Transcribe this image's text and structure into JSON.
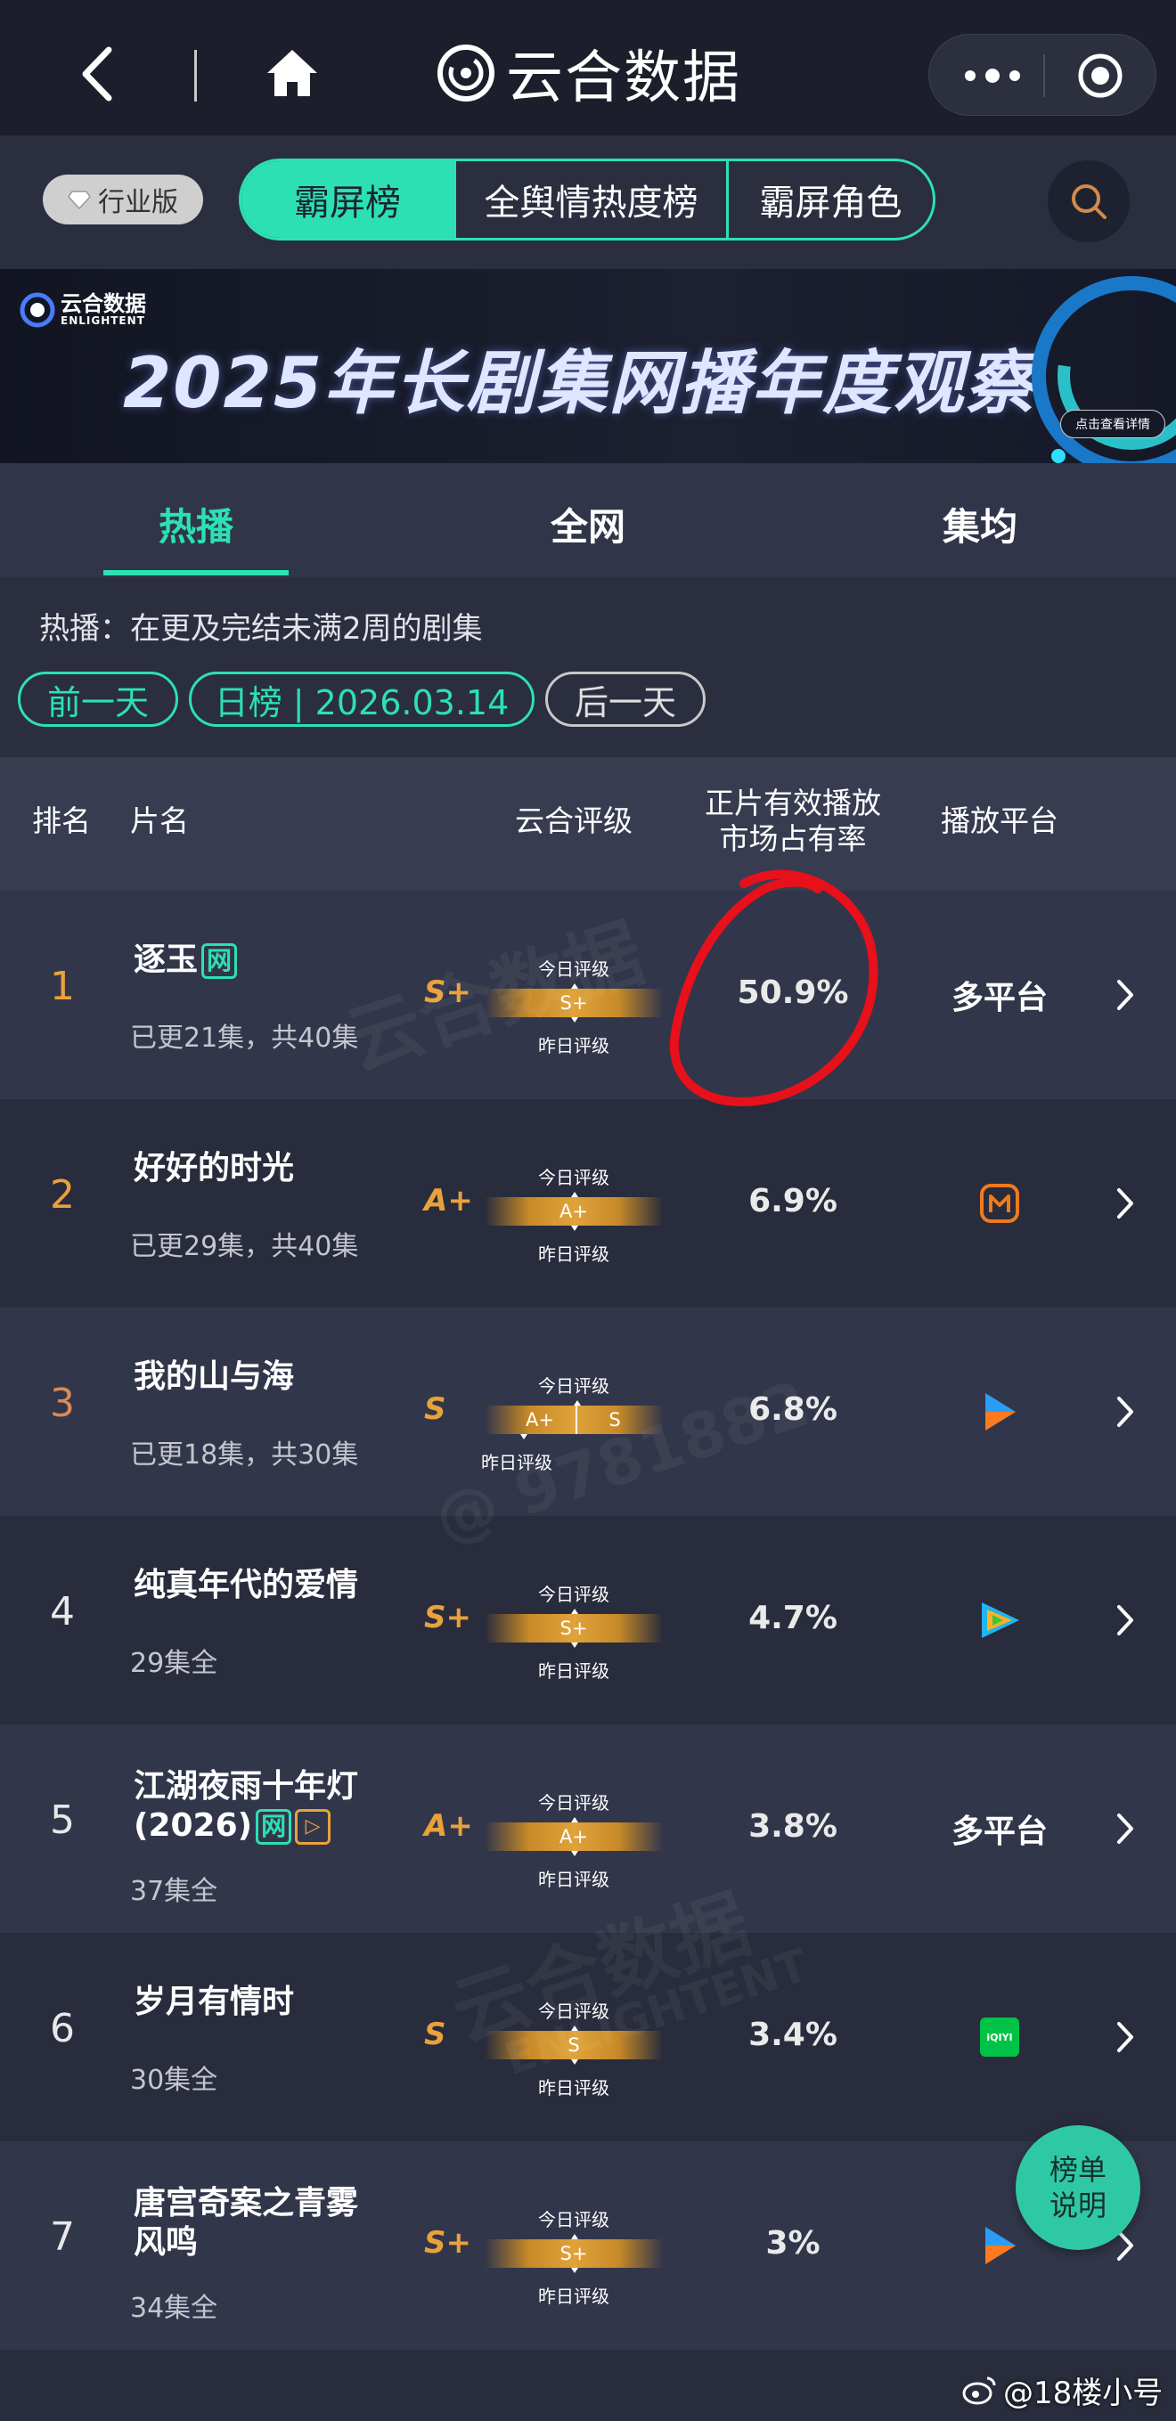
{
  "header": {
    "title": "云合数据",
    "back_icon": "back-arrow-icon",
    "home_icon": "home-icon"
  },
  "nav": {
    "edition": "行业版",
    "tabs": [
      {
        "label": "霸屏榜"
      },
      {
        "label": "全舆情热度榜"
      },
      {
        "label": "霸屏角色"
      }
    ],
    "active_tab": 0
  },
  "banner": {
    "brand": "云合数据",
    "brand_sub": "ENLIGHTENT",
    "headline": "2025年长剧集网播年度观察",
    "cta": "点击查看详情"
  },
  "subtabs": [
    {
      "label": "热播"
    },
    {
      "label": "全网"
    },
    {
      "label": "集均"
    }
  ],
  "active_subtab": 0,
  "info": {
    "description": "热播：在更及完结未满2周的剧集"
  },
  "date_nav": {
    "prev": "前一天",
    "current": "日榜 | 2026.03.14",
    "next": "后一天"
  },
  "table": {
    "columns": {
      "rank": "排名",
      "title": "片名",
      "rating": "云合评级",
      "share_line1": "正片有效播放",
      "share_line2": "市场占有率",
      "platform": "播放平台"
    }
  },
  "rating_labels": {
    "today": "今日评级",
    "yesterday": "昨日评级"
  },
  "rows": [
    {
      "rank": "1",
      "title": "逐玉",
      "tag_net": "网",
      "episodes": "已更21集，共40集",
      "grade": "S+",
      "today": "S+",
      "yesterday": "S+",
      "share": "50.9%",
      "platform": "多平台"
    },
    {
      "rank": "2",
      "title": "好好的时光",
      "episodes": "已更29集，共40集",
      "grade": "A+",
      "today": "A+",
      "yesterday": "A+",
      "share": "6.9%",
      "platform_icon": "mango-tv-icon"
    },
    {
      "rank": "3",
      "title": "我的山与海",
      "episodes": "已更18集，共30集",
      "grade": "S",
      "today": "A+",
      "yesterday": "S",
      "share": "6.8%",
      "platform_icon": "youku-icon"
    },
    {
      "rank": "4",
      "title": "纯真年代的爱情",
      "episodes": "29集全",
      "grade": "S+",
      "today": "S+",
      "yesterday": "S+",
      "share": "4.7%",
      "platform_icon": "tencent-video-icon"
    },
    {
      "rank": "5",
      "title": "江湖夜雨十年灯(2026)",
      "tag_net": "网",
      "episodes": "37集全",
      "grade": "A+",
      "today": "A+",
      "yesterday": "A+",
      "share": "3.8%",
      "platform": "多平台"
    },
    {
      "rank": "6",
      "title": "岁月有情时",
      "episodes": "30集全",
      "grade": "S",
      "today": "S",
      "yesterday": "S",
      "share": "3.4%",
      "platform_icon": "iqiyi-icon",
      "platform_text": "iQIYI"
    },
    {
      "rank": "7",
      "title": "唐宫奇案之青雾风鸣",
      "episodes": "34集全",
      "grade": "S+",
      "today": "S+",
      "yesterday": "S+",
      "share": "3%",
      "platform_icon": "youku-icon"
    }
  ],
  "explain_button": {
    "line1": "榜单",
    "line2": "说明"
  },
  "watermarks": [
    "云合数据",
    "ENLIGHTENT",
    "@ 9781882"
  ],
  "credit": "@18楼小号",
  "colors": {
    "accent": "#2de0b4",
    "gold": "#e9a23b",
    "annotation_red": "#e8101a"
  }
}
